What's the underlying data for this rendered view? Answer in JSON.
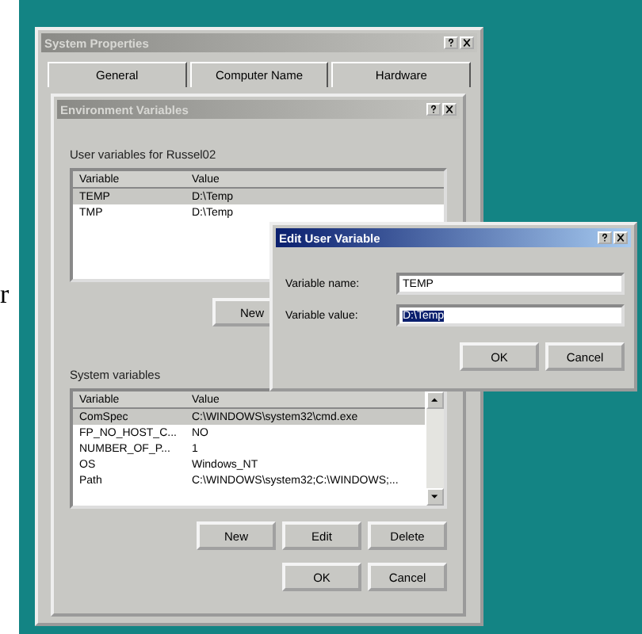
{
  "margin_text": "r",
  "system_properties": {
    "title": "System Properties",
    "tabs": [
      {
        "label": "General",
        "selected": false
      },
      {
        "label": "Computer Name",
        "selected": false
      },
      {
        "label": "Hardware",
        "selected": false
      }
    ]
  },
  "environment_variables": {
    "title": "Environment Variables",
    "user_group_label": "User variables for Russel02",
    "user_columns": [
      "Variable",
      "Value"
    ],
    "user_variables": [
      {
        "name": "TEMP",
        "value": "D:\\Temp",
        "selected": true
      },
      {
        "name": "TMP",
        "value": "D:\\Temp",
        "selected": false
      }
    ],
    "user_buttons": [
      "New"
    ],
    "system_group_label": "System variables",
    "system_columns": [
      "Variable",
      "Value"
    ],
    "system_variables": [
      {
        "name": "ComSpec",
        "value": "C:\\WINDOWS\\system32\\cmd.exe",
        "selected": true
      },
      {
        "name": "FP_NO_HOST_C...",
        "value": "NO",
        "selected": false
      },
      {
        "name": "NUMBER_OF_P...",
        "value": "1",
        "selected": false
      },
      {
        "name": "OS",
        "value": "Windows_NT",
        "selected": false
      },
      {
        "name": "Path",
        "value": "C:\\WINDOWS\\system32;C:\\WINDOWS;...",
        "selected": false
      }
    ],
    "system_buttons": [
      "New",
      "Edit",
      "Delete"
    ],
    "buttons": [
      "OK",
      "Cancel"
    ]
  },
  "edit_dialog": {
    "title": "Edit User Variable",
    "fields": [
      {
        "label": "Variable name:",
        "value": "TEMP",
        "selected": false
      },
      {
        "label": "Variable value:",
        "value": "D:\\Temp",
        "selected": true
      }
    ],
    "buttons": [
      "OK",
      "Cancel"
    ]
  }
}
